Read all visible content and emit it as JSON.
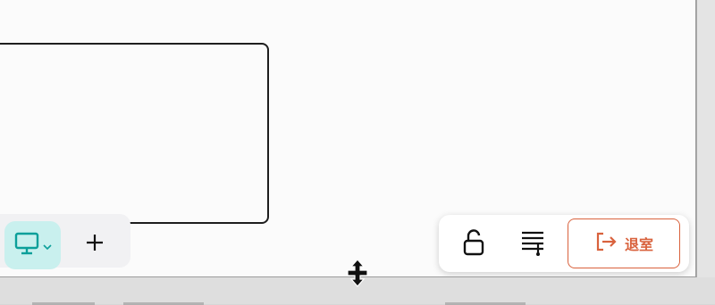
{
  "toolbar_left": {
    "device_icon": "monitor-icon",
    "device_dropdown_icon": "chevron-down-icon",
    "add_icon": "plus-icon"
  },
  "toolbar_right": {
    "lock_icon": "unlock-icon",
    "list_icon": "lines-icon",
    "exit_icon": "exit-icon",
    "exit_label": "退室"
  },
  "colors": {
    "accent_teal_bg": "#c9f0ee",
    "accent_teal": "#0b9f9a",
    "exit_red": "#d9623d"
  },
  "cursor_icon": "resize-vertical-cursor"
}
